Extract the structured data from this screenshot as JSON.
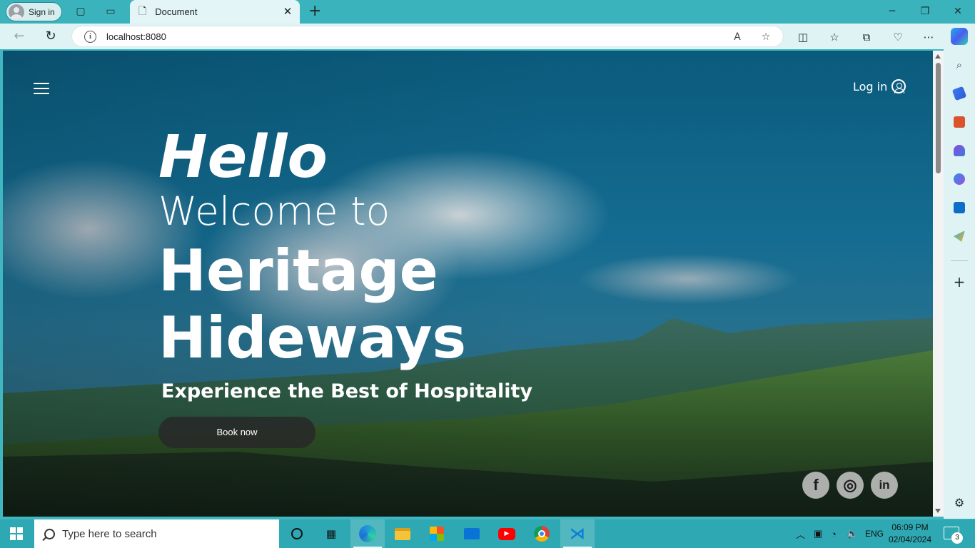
{
  "browser": {
    "signin_label": "Sign in",
    "tab_title": "Document",
    "url": "localhost:8080"
  },
  "page": {
    "login_label": "Log in",
    "hero": {
      "hello": "Hello",
      "welcome": "Welcome to",
      "heritage": "Heritage",
      "hideways": "Hideways",
      "tagline": "Experience the Best of Hospitality",
      "book_label": "Book now"
    },
    "social": [
      {
        "name": "facebook",
        "glyph": "f"
      },
      {
        "name": "instagram",
        "glyph": "◎"
      },
      {
        "name": "linkedin",
        "glyph": "in"
      }
    ]
  },
  "taskbar": {
    "search_placeholder": "Type here to search",
    "language": "ENG",
    "time": "06:09 PM",
    "date": "02/04/2024",
    "notification_count": "3"
  },
  "colors": {
    "accent": "#3ab3bd",
    "taskbar": "#2ea8b2"
  }
}
